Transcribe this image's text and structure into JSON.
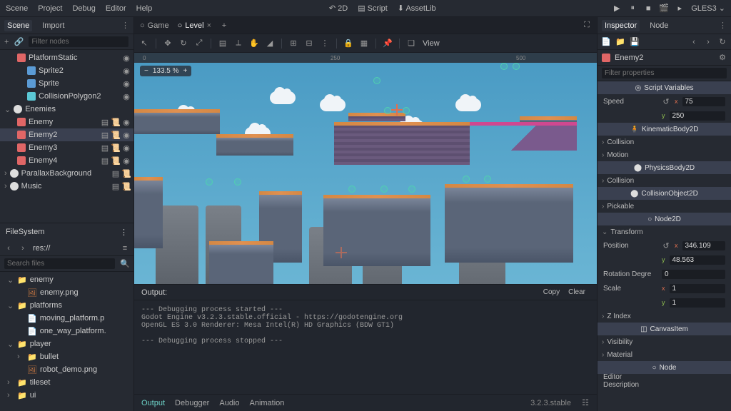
{
  "menubar": {
    "items": [
      "Scene",
      "Project",
      "Debug",
      "Editor",
      "Help"
    ],
    "center": {
      "mode2d": "2D",
      "script": "Script",
      "assetlib": "AssetLib"
    },
    "renderer": "GLES3"
  },
  "scene_panel": {
    "tabs": {
      "scene": "Scene",
      "import": "Import"
    },
    "filter_placeholder": "Filter nodes",
    "tree": [
      {
        "label": "PlatformStatic",
        "icon": "red",
        "indent": 1,
        "vis": true
      },
      {
        "label": "Sprite2",
        "icon": "blue",
        "indent": 2,
        "vis": true
      },
      {
        "label": "Sprite",
        "icon": "blue",
        "indent": 2,
        "vis": true
      },
      {
        "label": "CollisionPolygon2",
        "icon": "cyan",
        "indent": 2,
        "vis": true
      },
      {
        "label": "Enemies",
        "icon": "white",
        "indent": 0,
        "exp": true
      },
      {
        "label": "Enemy",
        "icon": "red",
        "indent": 1,
        "script": true,
        "vis": true
      },
      {
        "label": "Enemy2",
        "icon": "red",
        "indent": 1,
        "script": true,
        "vis": true,
        "selected": true
      },
      {
        "label": "Enemy3",
        "icon": "red",
        "indent": 1,
        "script": true,
        "vis": true
      },
      {
        "label": "Enemy4",
        "icon": "red",
        "indent": 1,
        "script": true,
        "vis": true
      },
      {
        "label": "ParallaxBackground",
        "icon": "white",
        "indent": 0,
        "script": true
      },
      {
        "label": "Music",
        "icon": "white",
        "indent": 0,
        "script": true
      }
    ]
  },
  "filesystem": {
    "title": "FileSystem",
    "path": "res://",
    "search_placeholder": "Search files",
    "tree": [
      {
        "label": "enemy",
        "kind": "folder",
        "indent": 0,
        "open": true
      },
      {
        "label": "enemy.png",
        "kind": "image",
        "indent": 1
      },
      {
        "label": "platforms",
        "kind": "folder",
        "indent": 0,
        "open": true
      },
      {
        "label": "moving_platform.p",
        "kind": "file",
        "indent": 1
      },
      {
        "label": "one_way_platform.",
        "kind": "file",
        "indent": 1
      },
      {
        "label": "player",
        "kind": "folder",
        "indent": 0,
        "open": true
      },
      {
        "label": "bullet",
        "kind": "folder",
        "indent": 1
      },
      {
        "label": "robot_demo.png",
        "kind": "image",
        "indent": 1
      },
      {
        "label": "tileset",
        "kind": "folder",
        "indent": 0
      },
      {
        "label": "ui",
        "kind": "folder",
        "indent": 0
      }
    ]
  },
  "center": {
    "tabs": [
      {
        "label": "Game",
        "active": false
      },
      {
        "label": "Level",
        "active": true
      }
    ],
    "zoom": "133.5 %",
    "view_label": "View",
    "ruler_marks": [
      "0",
      "250",
      "500"
    ]
  },
  "output": {
    "title": "Output:",
    "copy": "Copy",
    "clear": "Clear",
    "body": "--- Debugging process started ---\nGodot Engine v3.2.3.stable.official - https://godotengine.org\nOpenGL ES 3.0 Renderer: Mesa Intel(R) HD Graphics (BDW GT1)\n\n--- Debugging process stopped ---",
    "tabs": [
      "Output",
      "Debugger",
      "Audio",
      "Animation"
    ],
    "version": "3.2.3.stable"
  },
  "inspector": {
    "tabs": {
      "inspector": "Inspector",
      "node": "Node"
    },
    "node_name": "Enemy2",
    "filter_placeholder": "Filter properties",
    "sections": {
      "script_vars": "Script Variables",
      "kinematic": "KinematicBody2D",
      "physics": "PhysicsBody2D",
      "collision_obj": "CollisionObject2D",
      "node2d": "Node2D",
      "canvas_item": "CanvasItem",
      "node": "Node"
    },
    "props": {
      "speed_label": "Speed",
      "speed_x": "75",
      "speed_y": "250",
      "collision": "Collision",
      "motion": "Motion",
      "pickable": "Pickable",
      "transform": "Transform",
      "position_label": "Position",
      "pos_x": "346.109",
      "pos_y": "48.563",
      "rotation_label": "Rotation Degre",
      "rotation": "0",
      "scale_label": "Scale",
      "scale_x": "1",
      "scale_y": "1",
      "zindex": "Z Index",
      "visibility": "Visibility",
      "material": "Material",
      "editor_desc": "Editor Description"
    }
  }
}
